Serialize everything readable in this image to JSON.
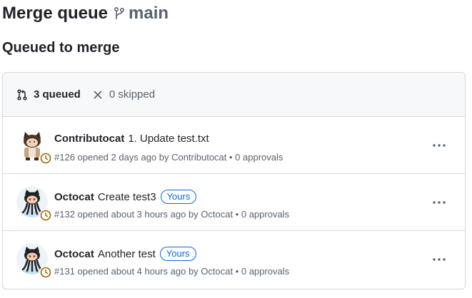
{
  "header": {
    "title": "Merge queue",
    "branch_icon": "git-branch-icon",
    "branch": "main"
  },
  "section": {
    "title": "Queued to merge"
  },
  "summary": {
    "queued_icon": "git-pull-request-icon",
    "queued_label": "3 queued",
    "skipped_icon": "x-icon",
    "skipped_label": "0 skipped"
  },
  "entries": [
    {
      "author": "Contributocat",
      "title": "1. Update test.txt",
      "meta": "#126 opened 2 days ago by Contributocat • 0 approvals",
      "avatar": "contributocat-avatar",
      "status_icon": "clock-icon"
    },
    {
      "author": "Octocat",
      "title": "Create test3",
      "badge": "Yours",
      "meta": "#132 opened about 3 hours ago by Octocat • 0 approvals",
      "avatar": "octocat-avatar",
      "status_icon": "clock-icon"
    },
    {
      "author": "Octocat",
      "title": "Another test",
      "badge": "Yours",
      "meta": "#131 opened about 4 hours ago by Octocat • 0 approvals",
      "avatar": "octocat-avatar",
      "status_icon": "clock-icon"
    }
  ],
  "colors": {
    "accent": "#0969da",
    "pending": "#9a6700",
    "border": "#d1d9e0",
    "muted": "#59636e"
  }
}
